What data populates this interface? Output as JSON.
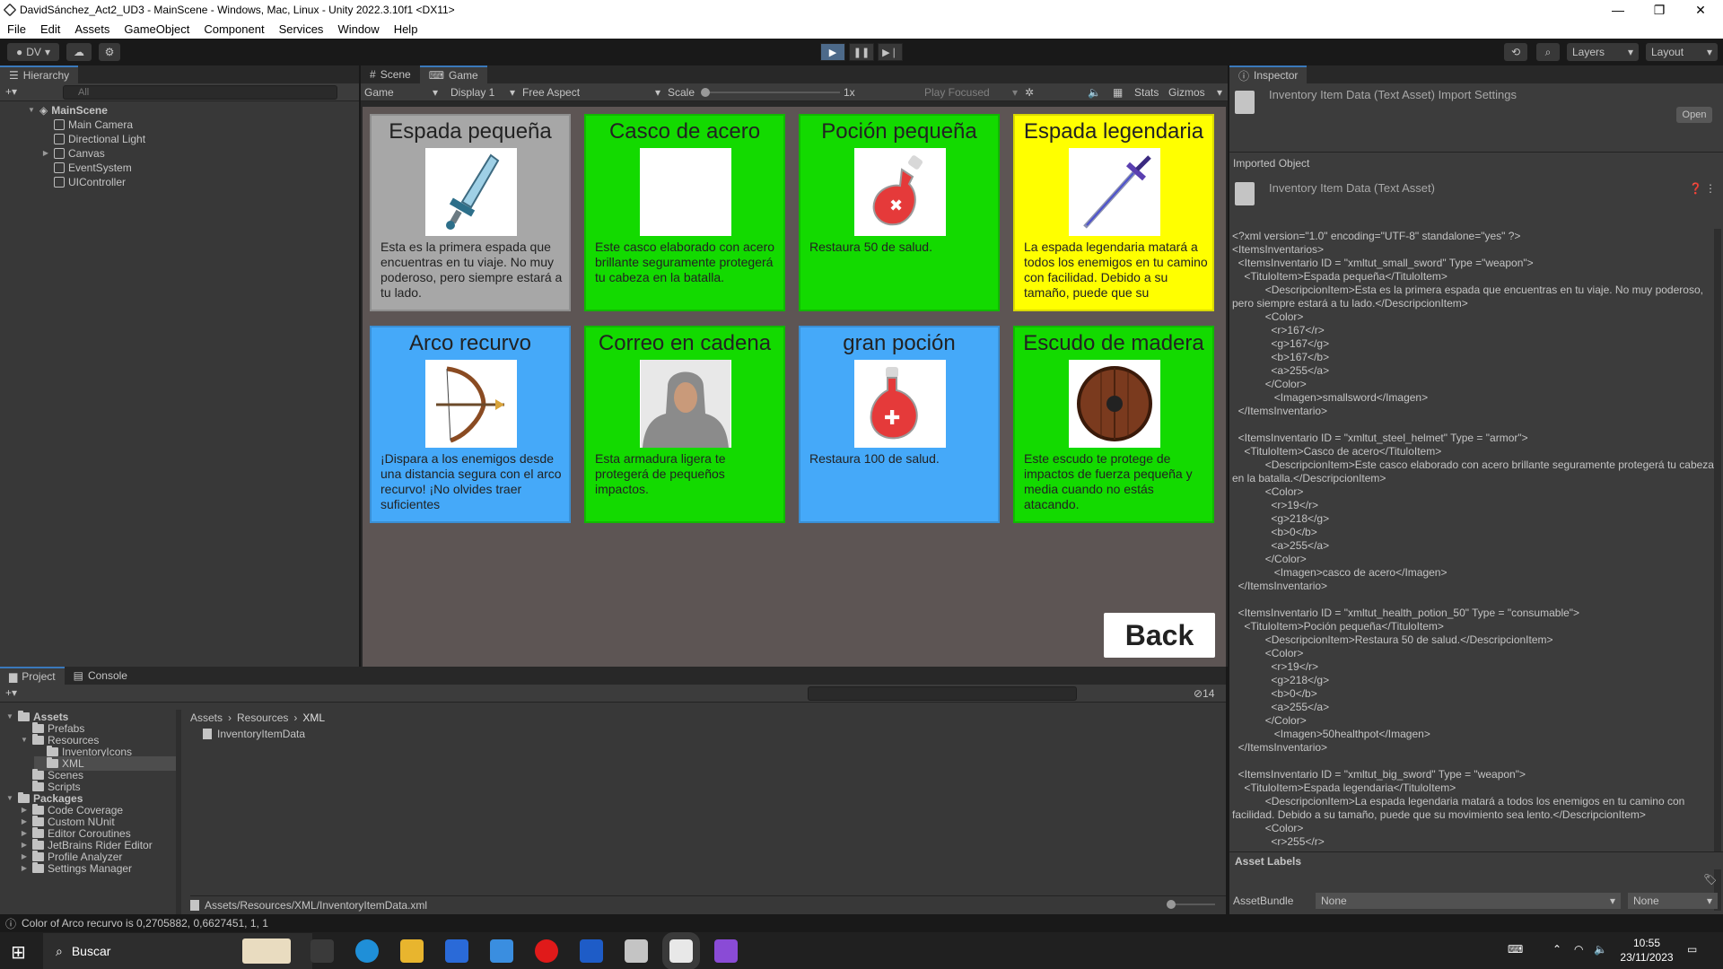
{
  "window": {
    "title": "DavidSánchez_Act2_UD3 - MainScene - Windows, Mac, Linux - Unity 2022.3.10f1 <DX11>",
    "minimize": "—",
    "restore": "❐",
    "close": "✕"
  },
  "menu": [
    "File",
    "Edit",
    "Assets",
    "GameObject",
    "Component",
    "Services",
    "Window",
    "Help"
  ],
  "toolbar": {
    "account": "DV",
    "layers": "Layers",
    "layout": "Layout"
  },
  "hierarchy": {
    "tab": "Hierarchy",
    "search_placeholder": "All",
    "scene": "MainScene",
    "items": [
      "Main Camera",
      "Directional Light",
      "Canvas",
      "EventSystem",
      "UIController"
    ]
  },
  "gameview": {
    "tabs": [
      "Scene",
      "Game"
    ],
    "mode": "Game",
    "display": "Display 1",
    "aspect": "Free Aspect",
    "scale_label": "Scale",
    "scale_value": "1x",
    "play_focused": "Play Focused",
    "stats": "Stats",
    "gizmos": "Gizmos",
    "back_label": "Back",
    "cards": [
      {
        "title": "Espada pequeña",
        "desc": "Esta es la primera espada que encuentras en tu viaje. No muy poderoso, pero siempre estará a tu lado.",
        "color": "#a7a7a7",
        "icon": "small-sword-icon"
      },
      {
        "title": "Casco de acero",
        "desc": "Este casco elaborado con acero brillante seguramente protegerá tu cabeza en la batalla.",
        "color": "#13da00",
        "icon": "steel-helmet-image"
      },
      {
        "title": "Poción pequeña",
        "desc": "Restaura 50 de salud.",
        "color": "#13da00",
        "icon": "small-potion-icon"
      },
      {
        "title": "Espada legendaria",
        "desc": "La espada legendaria matará a todos los enemigos en tu camino con facilidad. Debido a su tamaño, puede que su",
        "color": "#ffff00",
        "icon": "legendary-sword-icon"
      },
      {
        "title": "Arco recurvo",
        "desc": "¡Dispara a los enemigos desde una distancia segura con el arco recurvo! ¡No olvides traer suficientes",
        "color": "#45a9f9",
        "icon": "recurve-bow-icon"
      },
      {
        "title": "Correo en cadena",
        "desc": "Esta armadura ligera te protegerá de pequeños impactos.",
        "color": "#13da00",
        "icon": "chainmail-icon"
      },
      {
        "title": "gran poción",
        "desc": "Restaura 100 de salud.",
        "color": "#45a9f9",
        "icon": "big-potion-icon"
      },
      {
        "title": "Escudo de madera",
        "desc": "Este escudo te protege de impactos de fuerza pequeña y media cuando no estás atacando.",
        "color": "#13da00",
        "icon": "wooden-shield-icon"
      }
    ]
  },
  "inspector": {
    "tab": "Inspector",
    "header_title": "Inventory Item Data (Text Asset) Import Settings",
    "open_label": "Open",
    "imported_object": "Imported Object",
    "asset_title": "Inventory Item Data (Text Asset)",
    "xml_text": "<?xml version=\"1.0\" encoding=\"UTF-8\" standalone=\"yes\" ?>\n<ItemsInventarios>\n  <ItemsInventario ID = \"xmltut_small_sword\" Type =\"weapon\">\n    <TituloItem>Espada pequeña</TituloItem>\n           <DescripcionItem>Esta es la primera espada que encuentras en tu viaje. No muy poderoso, pero siempre estará a tu lado.</DescripcionItem>\n           <Color>\n             <r>167</r>\n             <g>167</g>\n             <b>167</b>\n             <a>255</a>\n           </Color>\n              <Imagen>smallsword</Imagen>\n  </ItemsInventario>\n\n  <ItemsInventario ID = \"xmltut_steel_helmet\" Type = \"armor\">\n    <TituloItem>Casco de acero</TituloItem>\n           <DescripcionItem>Este casco elaborado con acero brillante seguramente protegerá tu cabeza en la batalla.</DescripcionItem>\n           <Color>\n             <r>19</r>\n             <g>218</g>\n             <b>0</b>\n             <a>255</a>\n           </Color>\n              <Imagen>casco de acero</Imagen>\n  </ItemsInventario>\n\n  <ItemsInventario ID = \"xmltut_health_potion_50\" Type = \"consumable\">\n    <TituloItem>Poción pequeña</TituloItem>\n           <DescripcionItem>Restaura 50 de salud.</DescripcionItem>\n           <Color>\n             <r>19</r>\n             <g>218</g>\n             <b>0</b>\n             <a>255</a>\n           </Color>\n              <Imagen>50healthpot</Imagen>\n  </ItemsInventario>\n\n  <ItemsInventario ID = \"xmltut_big_sword\" Type = \"weapon\">\n    <TituloItem>Espada legendaria</TituloItem>\n           <DescripcionItem>La espada legendaria matará a todos los enemigos en tu camino con facilidad. Debido a su tamaño, puede que su movimiento sea lento.</DescripcionItem>\n           <Color>\n             <r>255</r>",
    "asset_labels": "Asset Labels",
    "asset_bundle_label": "AssetBundle",
    "asset_bundle_value": "None",
    "asset_bundle_variant": "None"
  },
  "project": {
    "tabs": [
      "Project",
      "Console"
    ],
    "tree": [
      {
        "label": "Assets",
        "bold": true,
        "indent": 0
      },
      {
        "label": "Prefabs",
        "indent": 1
      },
      {
        "label": "Resources",
        "indent": 1
      },
      {
        "label": "InventoryIcons",
        "indent": 2
      },
      {
        "label": "XML",
        "indent": 2
      },
      {
        "label": "Scenes",
        "indent": 1
      },
      {
        "label": "Scripts",
        "indent": 1
      },
      {
        "label": "Packages",
        "bold": true,
        "indent": 0
      },
      {
        "label": "Code Coverage",
        "indent": 1
      },
      {
        "label": "Custom NUnit",
        "indent": 1
      },
      {
        "label": "Editor Coroutines",
        "indent": 1
      },
      {
        "label": "JetBrains Rider Editor",
        "indent": 1
      },
      {
        "label": "Profile Analyzer",
        "indent": 1
      },
      {
        "label": "Settings Manager",
        "indent": 1
      }
    ],
    "breadcrumb": [
      "Assets",
      "Resources",
      "XML"
    ],
    "file": "InventoryItemData",
    "path": "Assets/Resources/XML/InventoryItemData.xml",
    "hidden_count": "14"
  },
  "status": "Color of Arco recurvo is 0,2705882, 0,6627451, 1, 1",
  "taskbar": {
    "search_placeholder": "Buscar",
    "time": "10:55",
    "date": "23/11/2023"
  }
}
